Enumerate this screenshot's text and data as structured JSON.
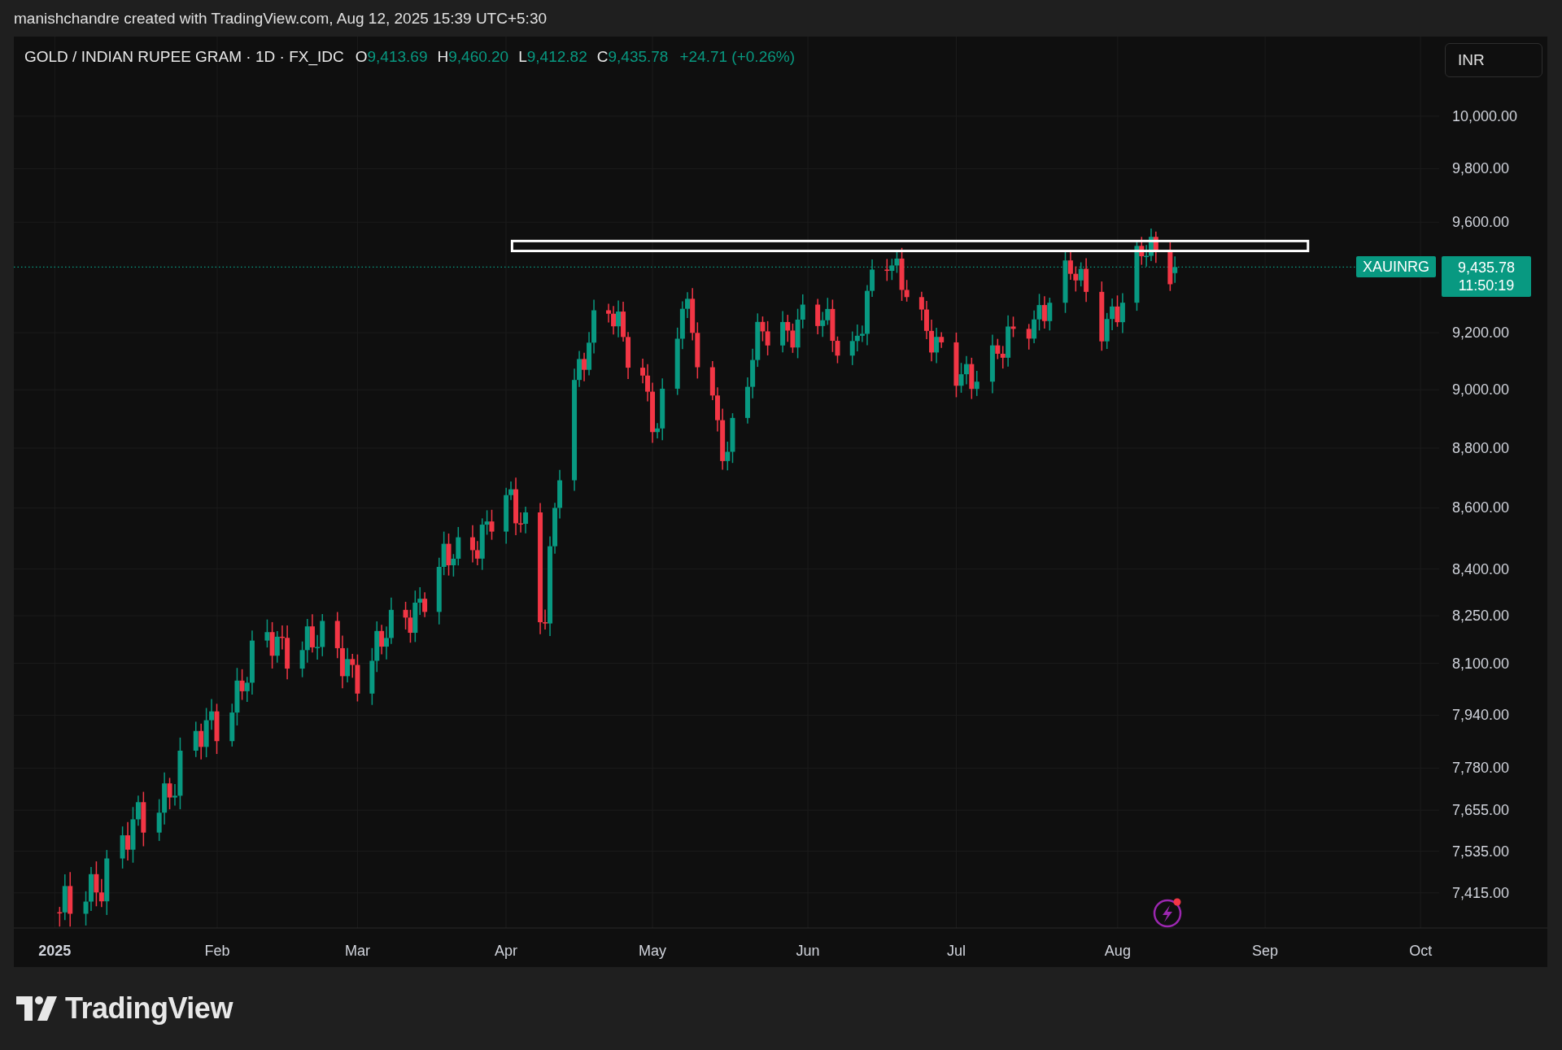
{
  "top_bar": {
    "text": "manishchandre created with TradingView.com, Aug 12, 2025 15:39 UTC+5:30"
  },
  "legend": {
    "symbol": "GOLD / INDIAN RUPEE GRAM · 1D · FX_IDC",
    "ohlc": [
      {
        "label": "O",
        "value": "9,413.69"
      },
      {
        "label": "H",
        "value": "9,460.20"
      },
      {
        "label": "L",
        "value": "9,412.82"
      },
      {
        "label": "C",
        "value": "9,435.78"
      }
    ],
    "change": "+24.71 (+0.26%)"
  },
  "currency_button": "INR",
  "price_axis": [
    "10,000.00",
    "9,800.00",
    "9,600.00",
    "9,200.00",
    "9,000.00",
    "8,800.00",
    "8,600.00",
    "8,400.00",
    "8,250.00",
    "8,100.00",
    "7,940.00",
    "7,780.00",
    "7,655.00",
    "7,535.00",
    "7,415.00"
  ],
  "time_axis": [
    "2025",
    "Feb",
    "Mar",
    "Apr",
    "May",
    "Jun",
    "Jul",
    "Aug",
    "Sep",
    "Oct"
  ],
  "last_price": {
    "symbol": "XAUINRG",
    "price": "9,435.78",
    "countdown": "11:50:19"
  },
  "footer": {
    "logo_text": "TradingView"
  }
}
